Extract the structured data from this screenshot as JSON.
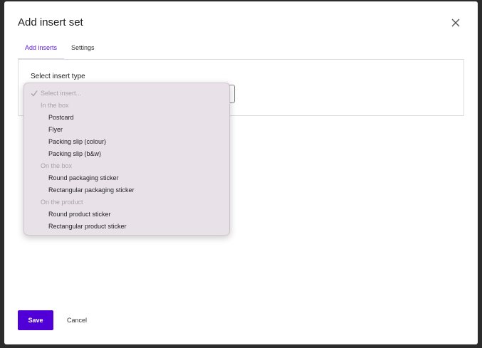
{
  "modal": {
    "title": "Add insert set"
  },
  "tabs": [
    {
      "label": "Add inserts",
      "active": true
    },
    {
      "label": "Settings",
      "active": false
    }
  ],
  "field": {
    "label": "Select insert type"
  },
  "dropdown": {
    "placeholder": "Select insert...",
    "groups": [
      {
        "label": "In the box",
        "options": [
          "Postcard",
          "Flyer",
          "Packing slip (colour)",
          "Packing slip (b&w)"
        ]
      },
      {
        "label": "On the box",
        "options": [
          "Round packaging sticker",
          "Rectangular packaging sticker"
        ]
      },
      {
        "label": "On the product",
        "options": [
          "Round product sticker",
          "Rectangular product sticker"
        ]
      }
    ]
  },
  "footer": {
    "save_label": "Save",
    "cancel_label": "Cancel"
  },
  "icons": {
    "close": "close-icon",
    "check": "check-icon"
  },
  "colors": {
    "accent": "#5000d6",
    "tab_active": "#5b16d9",
    "dropdown_bg": "#e8e1e8"
  }
}
